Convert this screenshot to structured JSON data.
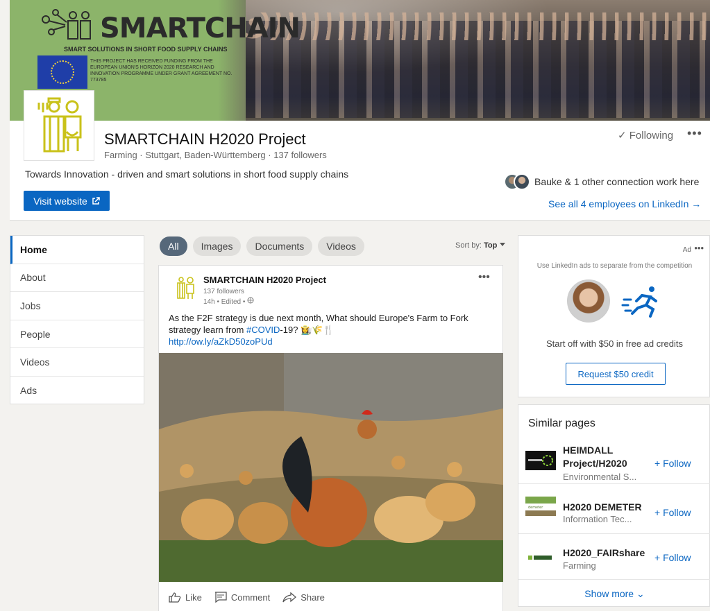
{
  "banner": {
    "title": "SMARTCHAIN",
    "subtitle": "SMART SOLUTIONS IN SHORT FOOD SUPPLY CHAINS",
    "funding_text": "THIS PROJECT HAS RECEIVED FUNDING FROM THE EUROPEAN UNION'S HORIZON 2020 RESEARCH AND INNOVATION PROGRAMME UNDER GRANT AGREEMENT NO. 773785"
  },
  "org": {
    "name": "SMARTCHAIN H2020 Project",
    "meta": "Farming · Stuttgart, Baden-Württemberg · 137 followers",
    "tagline": "Towards Innovation - driven and smart solutions in short food supply chains",
    "visit_label": "Visit website",
    "following_label": "✓ Following",
    "more": "•••",
    "connections": "Bauke & 1 other connection work here",
    "see_all": "See all 4 employees on LinkedIn →"
  },
  "nav": {
    "items": [
      {
        "label": "Home"
      },
      {
        "label": "About"
      },
      {
        "label": "Jobs"
      },
      {
        "label": "People"
      },
      {
        "label": "Videos"
      },
      {
        "label": "Ads"
      }
    ]
  },
  "filters": {
    "pills": [
      "All",
      "Images",
      "Documents",
      "Videos"
    ],
    "sort_prefix": "Sort by: ",
    "sort_value": "Top"
  },
  "post": {
    "author": "SMARTCHAIN H2020 Project",
    "followers": "137 followers",
    "time": "14h • Edited •",
    "more": "•••",
    "text_before": "As the F2F strategy is due next month,  What should Europe's Farm to Fork strategy learn from ",
    "hashtag": "#COVID",
    "text_after": "-19? 👩‍🌾🌾🍴",
    "link": "http://ow.ly/aZkD50zoPUd",
    "actions": {
      "like": "Like",
      "comment": "Comment",
      "share": "Share"
    }
  },
  "ad": {
    "label": "Ad",
    "more": "•••",
    "caption": "Use LinkedIn ads to separate from the competition",
    "credit_text": "Start off with $50 in free ad credits",
    "button": "Request $50 credit"
  },
  "similar": {
    "title": "Similar pages",
    "follow_label": "+ Follow",
    "show_more": "Show more ⌄",
    "pages": [
      {
        "name": "HEIMDALL Project/H2020",
        "industry": "Environmental S..."
      },
      {
        "name": "H2020 DEMETER",
        "industry": "Information Tec..."
      },
      {
        "name": "H2020_FAIRshare",
        "industry": "Farming"
      }
    ]
  },
  "colors": {
    "accent": "#0a66c2",
    "pill_active": "#56687a",
    "banner_green": "#8cb46a"
  }
}
